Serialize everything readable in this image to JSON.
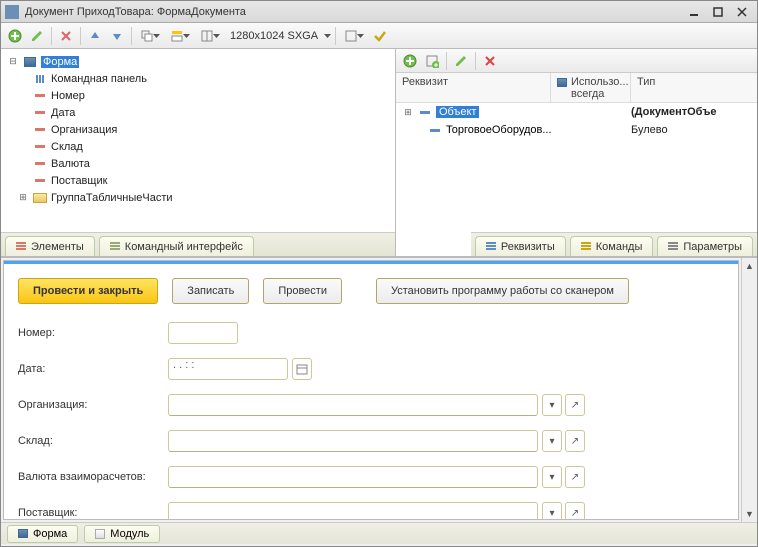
{
  "title": "Документ ПриходТовара: ФормаДокумента",
  "toolbar": {
    "resolution": "1280x1024 SXGA"
  },
  "left_tree": {
    "root": "Форма",
    "items": [
      "Командная панель",
      "Номер",
      "Дата",
      "Организация",
      "Склад",
      "Валюта",
      "Поставщик",
      "ГруппаТабличныеЧасти"
    ]
  },
  "left_tabs": {
    "elements": "Элементы",
    "cmdiface": "Командный интерфейс"
  },
  "right_header": {
    "col1": "Реквизит",
    "col2": "Использо...\nвсегда",
    "col3": "Тип"
  },
  "right_tree": {
    "root": {
      "name": "Объект",
      "type": "(ДокументОбъе"
    },
    "child": {
      "name": "ТорговоеОборудов...",
      "type": "Булево"
    }
  },
  "right_tabs": {
    "requisites": "Реквизиты",
    "commands": "Команды",
    "params": "Параметры"
  },
  "form": {
    "buttons": {
      "post_close": "Провести и закрыть",
      "write": "Записать",
      "post": "Провести",
      "scanner": "Установить программу работы со сканером"
    },
    "fields": {
      "number": "Номер:",
      "date": "Дата:",
      "date_placeholder": "  .  .       :  :  ",
      "org": "Организация:",
      "warehouse": "Склад:",
      "currency": "Валюта взаиморасчетов:",
      "supplier": "Поставщик:"
    }
  },
  "bottom_tabs": {
    "form": "Форма",
    "module": "Модуль"
  }
}
